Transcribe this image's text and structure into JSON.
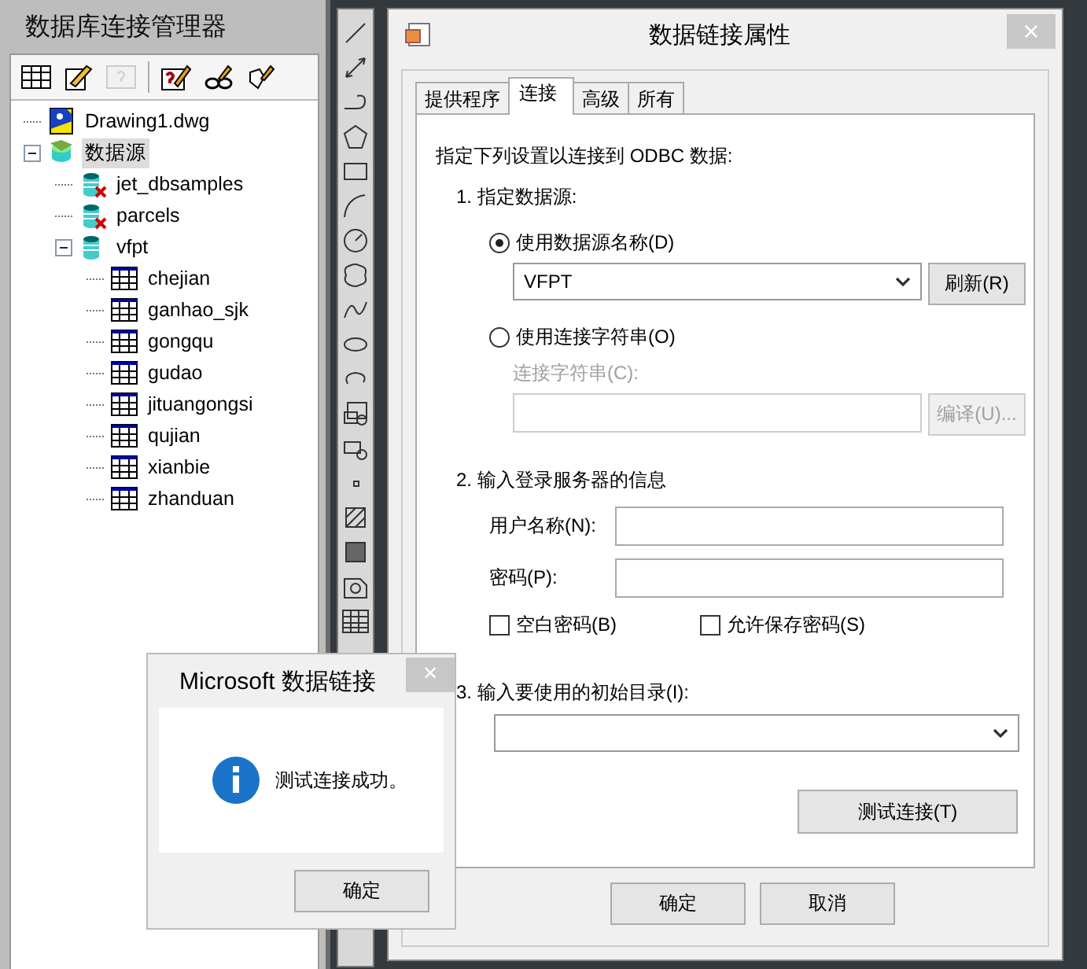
{
  "manager_panel": {
    "title": "数据库连接管理器",
    "toolbar": [
      {
        "kind": "table",
        "disabled": false
      },
      {
        "kind": "edit",
        "disabled": false
      },
      {
        "kind": "query",
        "disabled": true
      },
      {
        "kind": "sql",
        "disabled": false
      },
      {
        "kind": "link",
        "disabled": false
      },
      {
        "kind": "tag",
        "disabled": false
      }
    ],
    "tree": [
      {
        "label": "Drawing1.dwg",
        "kind": "drawing",
        "selected": false
      },
      {
        "label": "数据源",
        "kind": "datasource",
        "selected": true,
        "expanded": true,
        "children": [
          {
            "label": "jet_dbsamples",
            "kind": "db-error",
            "selected": false
          },
          {
            "label": "parcels",
            "kind": "db-error",
            "selected": false
          },
          {
            "label": "vfpt",
            "kind": "db",
            "selected": false,
            "expanded": true,
            "children": [
              {
                "label": "chejian",
                "kind": "table",
                "selected": false
              },
              {
                "label": "ganhao_sjk",
                "kind": "table",
                "selected": false
              },
              {
                "label": "gongqu",
                "kind": "table",
                "selected": false
              },
              {
                "label": "gudao",
                "kind": "table",
                "selected": false
              },
              {
                "label": "jituangongsi",
                "kind": "table",
                "selected": false
              },
              {
                "label": "qujian",
                "kind": "table",
                "selected": false
              },
              {
                "label": "xianbie",
                "kind": "table",
                "selected": false
              },
              {
                "label": "zhanduan",
                "kind": "table",
                "selected": false
              }
            ]
          }
        ]
      }
    ]
  },
  "dialog": {
    "title": "数据链接属性",
    "close": "×",
    "tabs": [
      {
        "label": "提供程序",
        "selected": false
      },
      {
        "label": "连接",
        "selected": true
      },
      {
        "label": "高级",
        "selected": false
      },
      {
        "label": "所有",
        "selected": false
      }
    ],
    "intro": "指定下列设置以连接到 ODBC 数据:",
    "step1": "1. 指定数据源:",
    "source_options": [
      {
        "label": "使用数据源名称(D)",
        "selected": true
      },
      {
        "label": "使用连接字符串(O)",
        "selected": false
      }
    ],
    "dsn_value": "VFPT",
    "refresh_button": "刷新(R)",
    "conn_string": {
      "label": "连接字符串(C):",
      "button": "编译(U)...",
      "disabled": true
    },
    "step2": "2. 输入登录服务器的信息",
    "user_label": "用户名称(N):",
    "password_label": "密码(P):",
    "checkboxes": [
      {
        "label": "空白密码(B)",
        "checked": false
      },
      {
        "label": "允许保存密码(S)",
        "checked": false
      }
    ],
    "step3": "3. 输入要使用的初始目录(I):",
    "test_button": "测试连接(T)",
    "buttons": [
      "确定",
      "取消"
    ]
  },
  "message_box": {
    "title": "Microsoft 数据链接",
    "close": "×",
    "message": "测试连接成功。",
    "button": "确定"
  }
}
